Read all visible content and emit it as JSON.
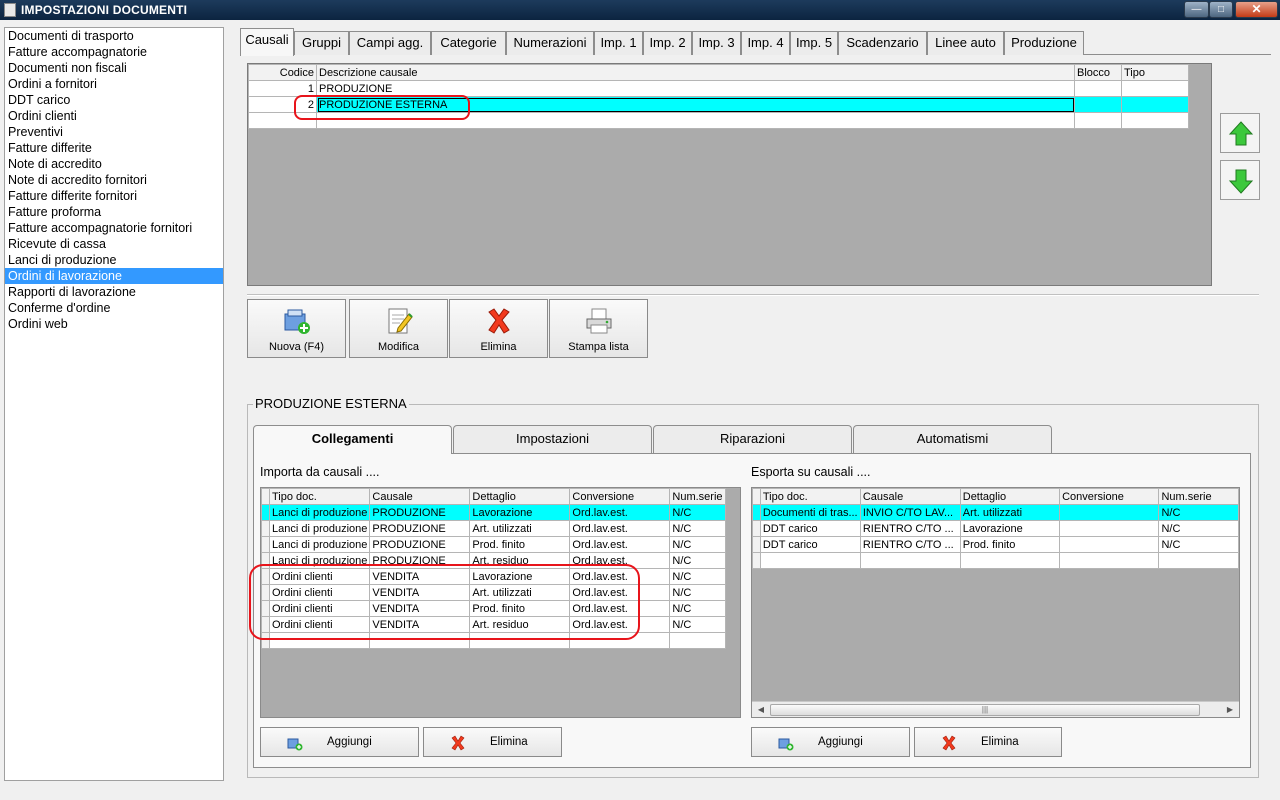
{
  "window": {
    "title": "IMPOSTAZIONI DOCUMENTI"
  },
  "left_list": {
    "items": [
      "Documenti di trasporto",
      "Fatture accompagnatorie",
      "Documenti non fiscali",
      "Ordini a fornitori",
      "DDT carico",
      "Ordini clienti",
      "Preventivi",
      "Fatture differite",
      "Note di accredito",
      "Note di accredito fornitori",
      "Fatture differite fornitori",
      "Fatture proforma",
      "Fatture accompagnatorie fornitori",
      "Ricevute di cassa",
      "Lanci di produzione",
      "Ordini di lavorazione",
      "Rapporti di lavorazione",
      "Conferme d'ordine",
      "Ordini web"
    ],
    "selected": "Ordini di lavorazione"
  },
  "top_tabs": [
    "Causali",
    "Gruppi",
    "Campi agg.",
    "Categorie",
    "Numerazioni",
    "Imp. 1",
    "Imp. 2",
    "Imp. 3",
    "Imp. 4",
    "Imp. 5",
    "Scadenzario",
    "Linee auto",
    "Produzione"
  ],
  "causali_grid": {
    "headers": {
      "codice": "Codice",
      "descrizione": "Descrizione causale",
      "blocco": "Blocco",
      "tipo": "Tipo"
    },
    "rows": [
      {
        "codice": "1",
        "descrizione": "PRODUZIONE",
        "blocco": "",
        "tipo": ""
      },
      {
        "codice": "2",
        "descrizione": "PRODUZIONE ESTERNA",
        "blocco": "",
        "tipo": ""
      }
    ]
  },
  "toolbar": {
    "nuova": "Nuova (F4)",
    "modifica": "Modifica",
    "elimina": "Elimina",
    "stampa": "Stampa lista"
  },
  "group": {
    "title": "PRODUZIONE ESTERNA",
    "tabs": [
      "Collegamenti",
      "Impostazioni",
      "Riparazioni",
      "Automatismi"
    ],
    "importa": {
      "label": "Importa da causali ....",
      "headers": [
        "Tipo doc.",
        "Causale",
        "Dettaglio",
        "Conversione",
        "Num.serie"
      ],
      "rows": [
        [
          "Lanci di produzione",
          "PRODUZIONE",
          "Lavorazione",
          "Ord.lav.est.",
          "N/C"
        ],
        [
          "Lanci di produzione",
          "PRODUZIONE",
          "Art. utilizzati",
          "Ord.lav.est.",
          "N/C"
        ],
        [
          "Lanci di produzione",
          "PRODUZIONE",
          "Prod. finito",
          "Ord.lav.est.",
          "N/C"
        ],
        [
          "Lanci di produzione",
          "PRODUZIONE",
          "Art. residuo",
          "Ord.lav.est.",
          "N/C"
        ],
        [
          "Ordini clienti",
          "VENDITA",
          "Lavorazione",
          "Ord.lav.est.",
          "N/C"
        ],
        [
          "Ordini clienti",
          "VENDITA",
          "Art. utilizzati",
          "Ord.lav.est.",
          "N/C"
        ],
        [
          "Ordini clienti",
          "VENDITA",
          "Prod. finito",
          "Ord.lav.est.",
          "N/C"
        ],
        [
          "Ordini clienti",
          "VENDITA",
          "Art. residuo",
          "Ord.lav.est.",
          "N/C"
        ]
      ]
    },
    "esporta": {
      "label": "Esporta su causali ....",
      "headers": [
        "Tipo doc.",
        "Causale",
        "Dettaglio",
        "Conversione",
        "Num.serie"
      ],
      "rows": [
        [
          "Documenti di tras...",
          "INVIO C/TO LAV...",
          "Art. utilizzati",
          "",
          "N/C"
        ],
        [
          "DDT carico",
          "RIENTRO C/TO ...",
          "Lavorazione",
          "",
          "N/C"
        ],
        [
          "DDT carico",
          "RIENTRO C/TO ...",
          "Prod. finito",
          "",
          "N/C"
        ]
      ]
    },
    "aggiungi": "Aggiungi",
    "elimina": "Elimina"
  }
}
